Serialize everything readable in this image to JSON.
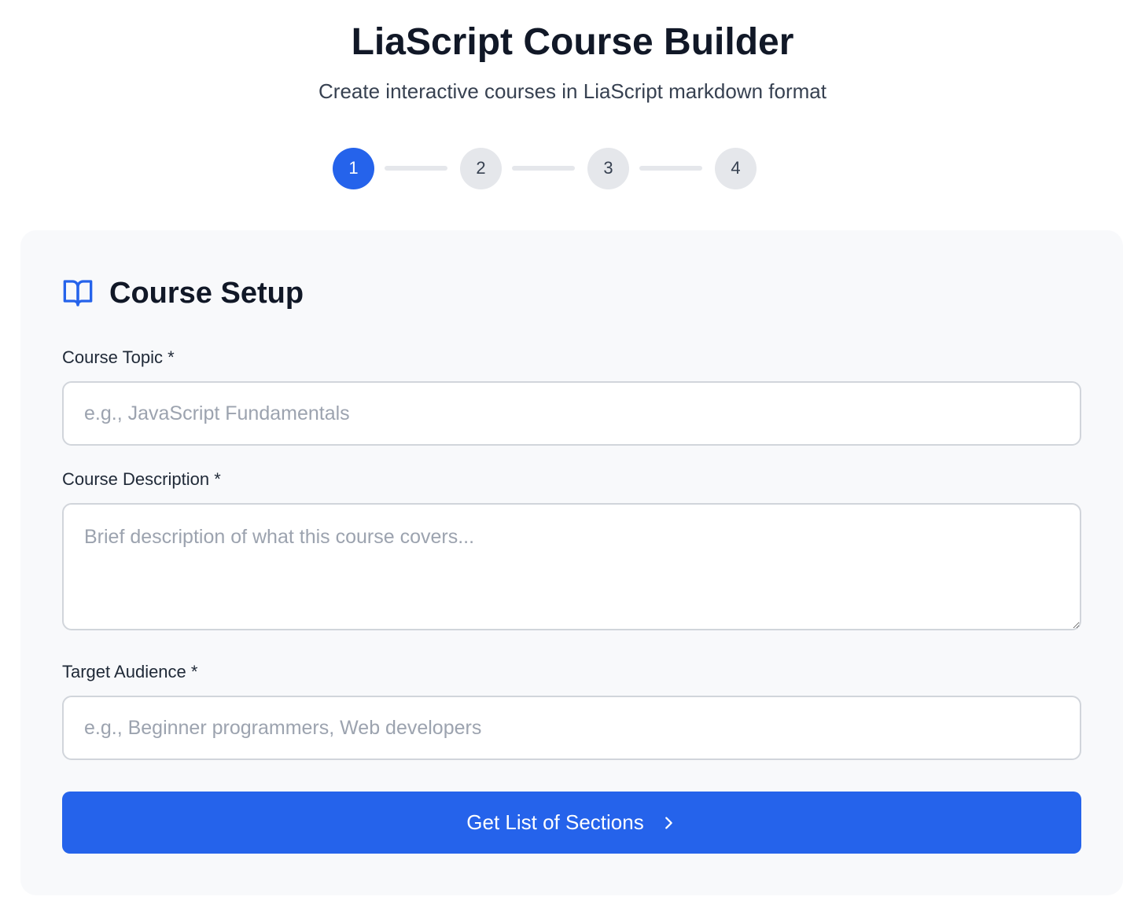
{
  "header": {
    "title": "LiaScript Course Builder",
    "subtitle": "Create interactive courses in LiaScript markdown format"
  },
  "stepper": {
    "steps": [
      "1",
      "2",
      "3",
      "4"
    ],
    "active_step": 1
  },
  "card": {
    "icon": "book-open-icon",
    "title": "Course Setup",
    "fields": {
      "topic": {
        "label": "Course Topic *",
        "value": "",
        "placeholder": "e.g., JavaScript Fundamentals"
      },
      "description": {
        "label": "Course Description *",
        "value": "",
        "placeholder": "Brief description of what this course covers..."
      },
      "audience": {
        "label": "Target Audience *",
        "value": "",
        "placeholder": "e.g., Beginner programmers, Web developers"
      }
    },
    "submit_label": "Get List of Sections",
    "submit_icon": "chevron-right-icon"
  },
  "colors": {
    "accent": "#2563eb",
    "inactive_step": "#e5e7eb",
    "card_background": "#f8f9fb",
    "placeholder_text": "#9ca3af"
  }
}
